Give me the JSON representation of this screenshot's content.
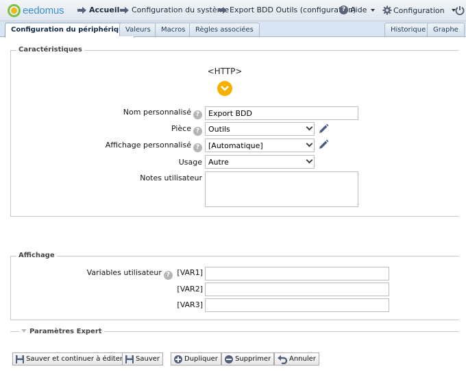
{
  "header": {
    "logo_text": "eedomus",
    "nav": [
      {
        "label": "Accueil",
        "icon": "arrow-right-icon"
      },
      {
        "label": "Configuration du système",
        "icon": "arrow-right-icon"
      },
      {
        "label": "Export BDD Outils (configuration)",
        "icon": "arrow-right-icon"
      },
      {
        "label": "Aide",
        "icon": "help-icon"
      },
      {
        "label": "Configuration",
        "icon": "gear-icon"
      }
    ]
  },
  "tabs": {
    "left": [
      "Configuration du périphérique",
      "Valeurs",
      "Macros",
      "Règles associées"
    ],
    "right": [
      "Historique",
      "Graphe"
    ],
    "active": "Configuration du périphérique"
  },
  "characteristics": {
    "legend": "Caractéristiques",
    "device_type": "<HTTP>",
    "fields": {
      "name": {
        "label": "Nom personnalisé",
        "value": "Export BDD"
      },
      "room": {
        "label": "Pièce",
        "value": "Outils"
      },
      "display": {
        "label": "Affichage personnalisé",
        "value": "[Automatique]"
      },
      "usage": {
        "label": "Usage",
        "value": "Autre"
      },
      "notes": {
        "label": "Notes utilisateur",
        "value": ""
      }
    }
  },
  "display_section": {
    "legend": "Affichage",
    "variables_label": "Variables utilisateur",
    "vars": [
      {
        "label": "[VAR1]",
        "value": ""
      },
      {
        "label": "[VAR2]",
        "value": ""
      },
      {
        "label": "[VAR3]",
        "value": ""
      }
    ]
  },
  "expert": {
    "label": "Paramètres Expert"
  },
  "buttons": {
    "save_continue": "Sauver et continuer à éditer",
    "save": "Sauver",
    "duplicate": "Dupliquer",
    "delete": "Supprimer",
    "cancel": "Annuler"
  },
  "colors": {
    "accent": "#f5b000",
    "brand_blue": "#3a8fd0",
    "brand_green": "#7cc242"
  }
}
